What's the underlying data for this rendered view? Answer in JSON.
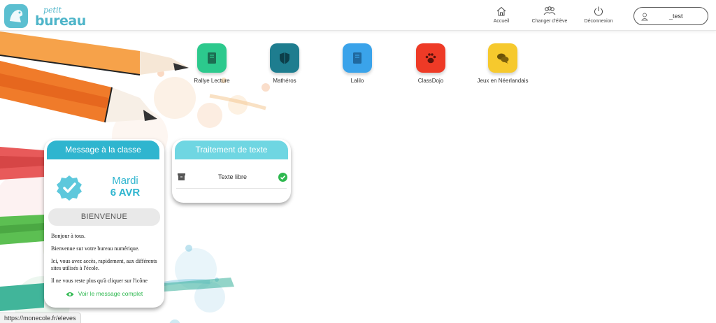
{
  "logo": {
    "small": "petit",
    "big": "bureau"
  },
  "nav": {
    "home": "Accueil",
    "change_student": "Changer d'élève",
    "logout": "Déconnexion"
  },
  "user": {
    "name": "_test"
  },
  "apps": [
    {
      "label": "Rallye Lecture",
      "color": "#2cc98d",
      "icon": "book-icon"
    },
    {
      "label": "Mathéros",
      "color": "#1e7d8f",
      "icon": "shield-icon"
    },
    {
      "label": "Lalilo",
      "color": "#3aa3ea",
      "icon": "book-icon"
    },
    {
      "label": "ClassDojo",
      "color": "#ee3a26",
      "icon": "paw-icon"
    },
    {
      "label": "Jeux en Néerlandais",
      "color": "#f6c92d",
      "icon": "chat-icon"
    }
  ],
  "message_card": {
    "title": "Message à la classe",
    "day": "Mardi",
    "date": "6 AVR",
    "heading": "BIENVENUE",
    "paragraphs": [
      "Bonjour  à tous.",
      "Bienvenue sur votre bureau numérique.",
      "Ici, vous avez accès, rapidement, aux différents sites utilisés à l'école.",
      "Il ne vous reste plus qu'à cliquer sur l'icône"
    ],
    "see_full": "Voir le message complet"
  },
  "text_card": {
    "title": "Traitement de texte",
    "item": "Texte libre"
  },
  "status_url": "https://monecole.fr/eleves",
  "colors": {
    "accent": "#2fb5cf",
    "accent_light": "#6fd6e2",
    "success": "#2eb84f"
  }
}
